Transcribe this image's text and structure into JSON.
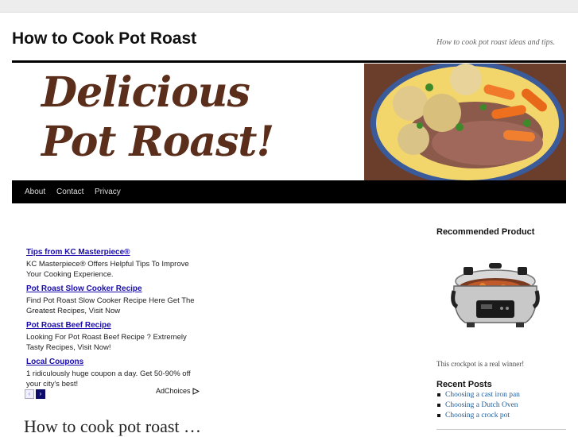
{
  "site": {
    "title": "How to Cook Pot Roast",
    "tagline": "How to cook pot roast ideas and tips."
  },
  "banner": {
    "line1": "Delicious",
    "line2": "Pot Roast!"
  },
  "nav": {
    "items": [
      "About",
      "Contact",
      "Privacy"
    ]
  },
  "ads": {
    "items": [
      {
        "title": "Tips from KC Masterpiece®",
        "desc": "KC Masterpiece® Offers Helpful Tips To Improve Your Cooking Experience."
      },
      {
        "title": "Pot Roast Slow Cooker Recipe",
        "desc": "Find Pot Roast Slow Cooker Recipe Here Get The Greatest Recipes, Visit Now"
      },
      {
        "title": "Pot Roast Beef Recipe",
        "desc": "Looking For Pot Roast Beef Recipe ? Extremely Tasty Recipes, Visit Now!"
      },
      {
        "title": "Local Coupons",
        "desc": "1 ridiculously huge coupon a day. Get 50-90% off your city's best!"
      }
    ],
    "prev_label": "‹",
    "next_label": "›",
    "adchoices_label": "AdChoices"
  },
  "main": {
    "post_title": "How to cook pot roast …"
  },
  "sidebar": {
    "recommended_heading": "Recommended Product",
    "product_caption": "This crockpot is a real winner!",
    "recent_heading": "Recent Posts",
    "recent_posts": [
      "Choosing a cast iron pan",
      "Choosing a Dutch Oven",
      "Choosing a crock pot"
    ]
  }
}
